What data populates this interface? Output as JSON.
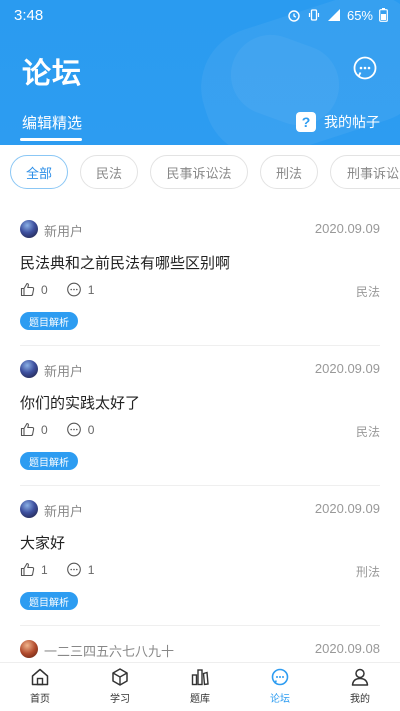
{
  "status_bar": {
    "time": "3:48",
    "battery": "65%"
  },
  "header": {
    "title": "论坛",
    "tab_featured": "编辑精选",
    "my_posts": "我的帖子",
    "my_posts_icon_char": "?"
  },
  "chips": [
    "全部",
    "民法",
    "民事诉讼法",
    "刑法",
    "刑事诉讼"
  ],
  "posts": [
    {
      "author": "新用户",
      "date": "2020.09.09",
      "title": "民法典和之前民法有哪些区别啊",
      "likes": "0",
      "comments": "1",
      "category": "民法",
      "tag": "题目解析"
    },
    {
      "author": "新用户",
      "date": "2020.09.09",
      "title": "你们的实践太好了",
      "likes": "0",
      "comments": "0",
      "category": "民法",
      "tag": "题目解析"
    },
    {
      "author": "新用户",
      "date": "2020.09.09",
      "title": "大家好",
      "likes": "1",
      "comments": "1",
      "category": "刑法",
      "tag": "题目解析"
    },
    {
      "author": "一二三四五六七八九十",
      "date": "2020.09.08"
    }
  ],
  "nav": [
    {
      "label": "首页",
      "icon": "home-icon"
    },
    {
      "label": "学习",
      "icon": "study-icon"
    },
    {
      "label": "题库",
      "icon": "question-bank-icon"
    },
    {
      "label": "论坛",
      "icon": "forum-icon"
    },
    {
      "label": "我的",
      "icon": "profile-icon"
    }
  ],
  "colors": {
    "primary": "#2d9cf1",
    "active_nav": "#2d9cf1"
  }
}
